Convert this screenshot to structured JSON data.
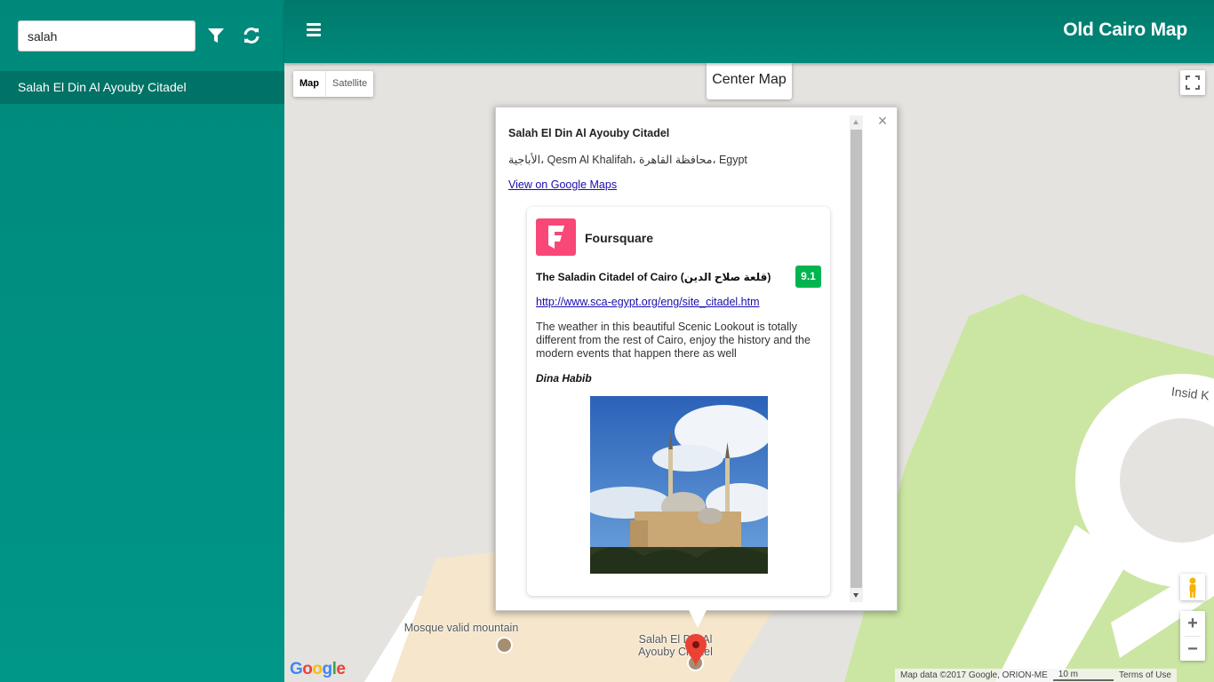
{
  "app": {
    "title": "Old Cairo Map"
  },
  "sidebar": {
    "search": {
      "value": "salah",
      "placeholder": ""
    },
    "filter_icon": "filter-icon",
    "refresh_icon": "refresh-icon",
    "items": [
      {
        "label": "Salah El Din Al Ayouby Citadel"
      }
    ]
  },
  "map": {
    "type_controls": {
      "map_label": "Map",
      "satellite_label": "Satellite",
      "selected": "Map"
    },
    "center_button": "Center Map",
    "labels": {
      "mosque": "Mosque valid mountain",
      "citadel_line1": "Salah El Din Al",
      "citadel_line2": "Ayouby Citadel",
      "road": "Insid K"
    },
    "zoom_in": "+",
    "zoom_out": "−",
    "google": "Google",
    "attribution": {
      "data": "Map data ©2017 Google, ORION-ME",
      "scale": "10 m",
      "terms": "Terms of Use"
    }
  },
  "infowindow": {
    "title": "Salah El Din Al Ayouby Citadel",
    "address": "الأباجية، Qesm Al Khalifah، محافظة القاهرة، Egypt",
    "link": "View on Google Maps",
    "foursquare": {
      "brand": "Foursquare",
      "venue_name": "The Saladin Citadel of Cairo (قلعة صلاح الدين)",
      "score": "9.1",
      "url": "http://www.sca-egypt.org/eng/site_citadel.htm",
      "tip": "The weather in this beautiful Scenic Lookout is totally different from the rest of Cairo, enjoy the history and the modern events that happen there as well",
      "user": "Dina Habib",
      "brand_color": "#f94877",
      "score_color": "#00b551"
    }
  },
  "colors": {
    "primary": "#009688",
    "header": "#00796b"
  }
}
